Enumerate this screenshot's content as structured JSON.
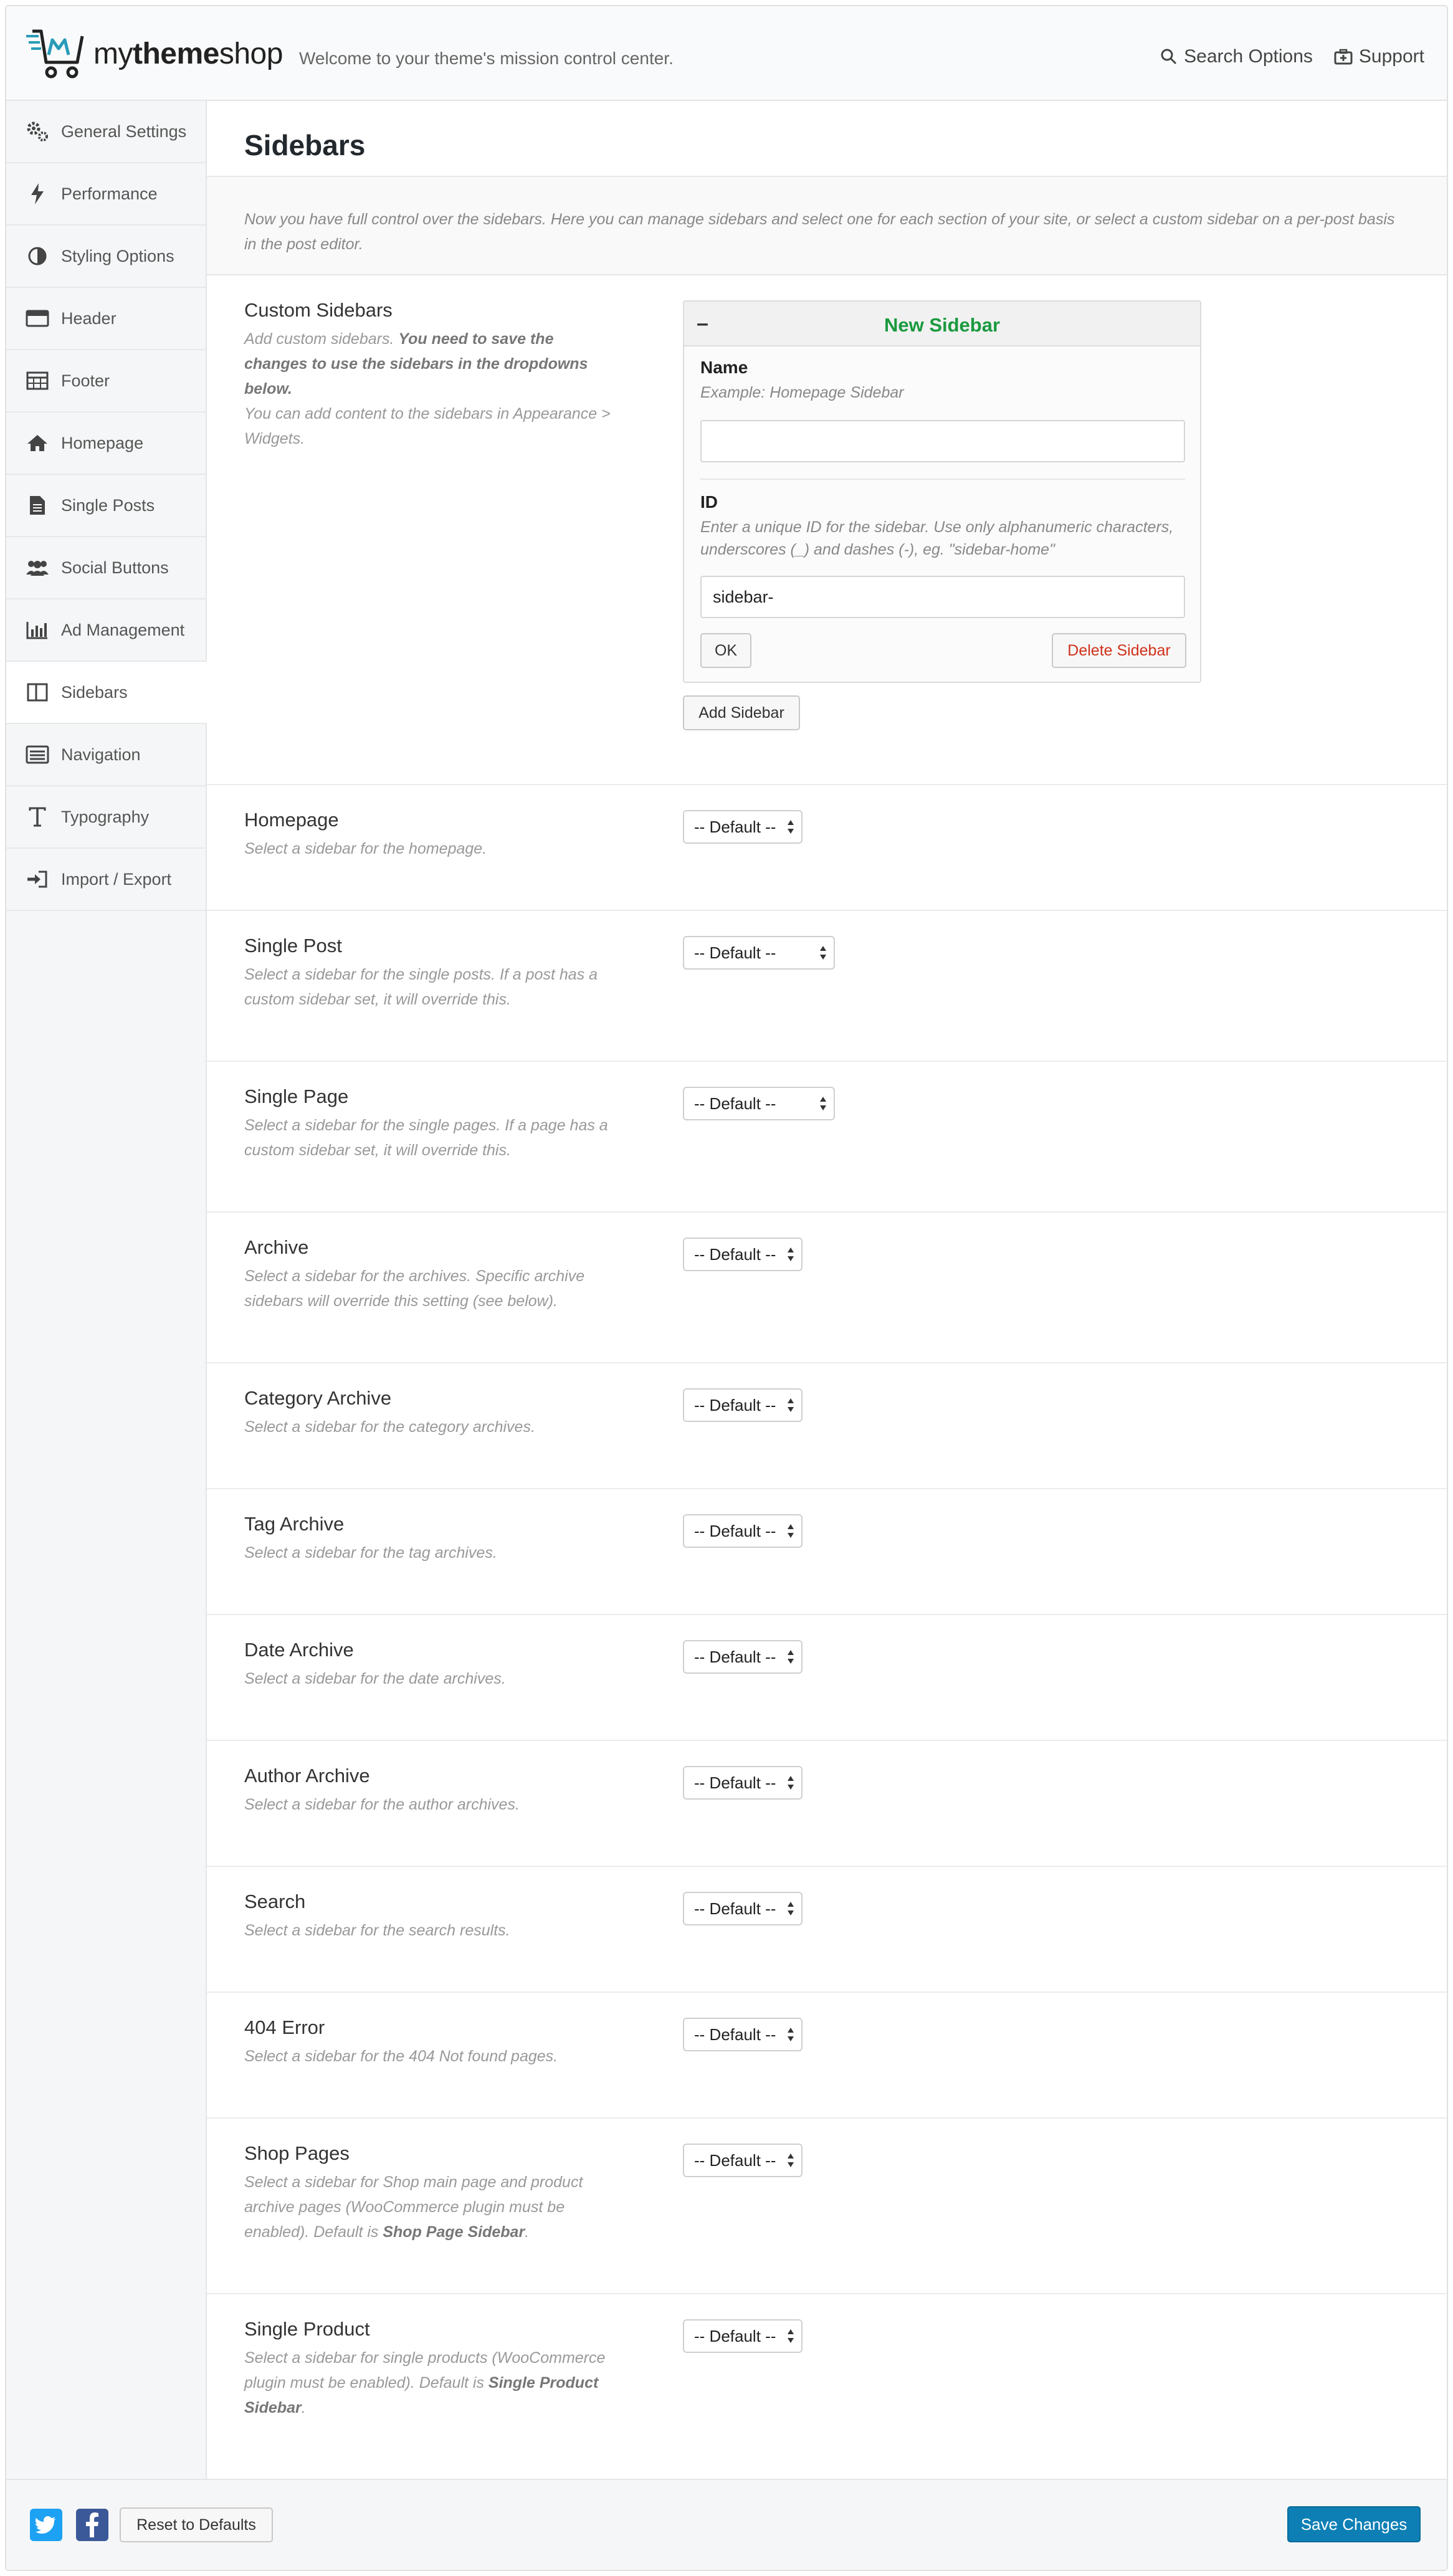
{
  "header": {
    "brand_light": "my",
    "brand_bold": "theme",
    "brand_rest": "shop",
    "tagline": "Welcome to your theme's mission control center.",
    "search_label": "Search Options",
    "support_label": "Support"
  },
  "nav": [
    {
      "label": "General Settings",
      "icon": "gears-icon"
    },
    {
      "label": "Performance",
      "icon": "bolt-icon"
    },
    {
      "label": "Styling Options",
      "icon": "contrast-icon"
    },
    {
      "label": "Header",
      "icon": "header-card-icon"
    },
    {
      "label": "Footer",
      "icon": "table-icon"
    },
    {
      "label": "Homepage",
      "icon": "home-icon"
    },
    {
      "label": "Single Posts",
      "icon": "document-icon"
    },
    {
      "label": "Social Buttons",
      "icon": "users-icon"
    },
    {
      "label": "Ad Management",
      "icon": "bar-chart-icon"
    },
    {
      "label": "Sidebars",
      "icon": "columns-icon",
      "active": true
    },
    {
      "label": "Navigation",
      "icon": "list-icon"
    },
    {
      "label": "Typography",
      "icon": "text-icon"
    },
    {
      "label": "Import / Export",
      "icon": "sign-in-icon"
    }
  ],
  "main": {
    "title": "Sidebars",
    "intro": "Now you have full control over the sidebars. Here you can manage sidebars and select one for each section of your site, or select a custom sidebar on a per-post basis in the post editor."
  },
  "custom_sidebars": {
    "title": "Custom Sidebars",
    "desc_1": "Add custom sidebars. ",
    "desc_bold": "You need to save the changes to use the sidebars in the dropdowns below.",
    "desc_2": "You can add content to the sidebars in Appearance > Widgets.",
    "box": {
      "toggle": "–",
      "title": "New Sidebar",
      "name_label": "Name",
      "name_hint": "Example: Homepage Sidebar",
      "name_value": "",
      "id_label": "ID",
      "id_hint": "Enter a unique ID for the sidebar. Use only alphanumeric characters, underscores (_) and dashes (-), eg. \"sidebar-home\"",
      "id_value": "sidebar-",
      "ok_label": "OK",
      "delete_label": "Delete Sidebar"
    },
    "add_label": "Add Sidebar"
  },
  "rows": [
    {
      "title": "Homepage",
      "desc": "Select a sidebar for the homepage.",
      "value": "-- Default --"
    },
    {
      "title": "Single Post",
      "desc": "Select a sidebar for the single posts. If a post has a custom sidebar set, it will override this.",
      "value": "-- Default --"
    },
    {
      "title": "Single Page",
      "desc": "Select a sidebar for the single pages. If a page has a custom sidebar set, it will override this.",
      "value": "-- Default --"
    },
    {
      "title": "Archive",
      "desc": "Select a sidebar for the archives. Specific archive sidebars will override this setting (see below).",
      "value": "-- Default --"
    },
    {
      "title": "Category Archive",
      "desc": "Select a sidebar for the category archives.",
      "value": "-- Default --"
    },
    {
      "title": "Tag Archive",
      "desc": "Select a sidebar for the tag archives.",
      "value": "-- Default --"
    },
    {
      "title": "Date Archive",
      "desc": "Select a sidebar for the date archives.",
      "value": "-- Default --"
    },
    {
      "title": "Author Archive",
      "desc": "Select a sidebar for the author archives.",
      "value": "-- Default --"
    },
    {
      "title": "Search",
      "desc": "Select a sidebar for the search results.",
      "value": "-- Default --"
    },
    {
      "title": "404 Error",
      "desc": "Select a sidebar for the 404 Not found pages.",
      "value": "-- Default --"
    },
    {
      "title": "Shop Pages",
      "desc": "Select a sidebar for Shop main page and product archive pages (WooCommerce plugin must be enabled). Default is ",
      "desc_bold": "Shop Page Sidebar",
      "desc_end": ".",
      "value": "-- Default --"
    },
    {
      "title": "Single Product",
      "desc": "Select a sidebar for single products (WooCommerce plugin must be enabled). Default is ",
      "desc_bold": "Single Product Sidebar",
      "desc_end": ".",
      "value": "-- Default --"
    }
  ],
  "footer": {
    "reset_label": "Reset to Defaults",
    "save_label": "Save Changes"
  },
  "colors": {
    "accent": "#0d7fb5",
    "new_sidebar_title": "#1a9a3f",
    "delete": "#d0321b",
    "twitter": "#1da1f2",
    "facebook": "#3b5998"
  }
}
